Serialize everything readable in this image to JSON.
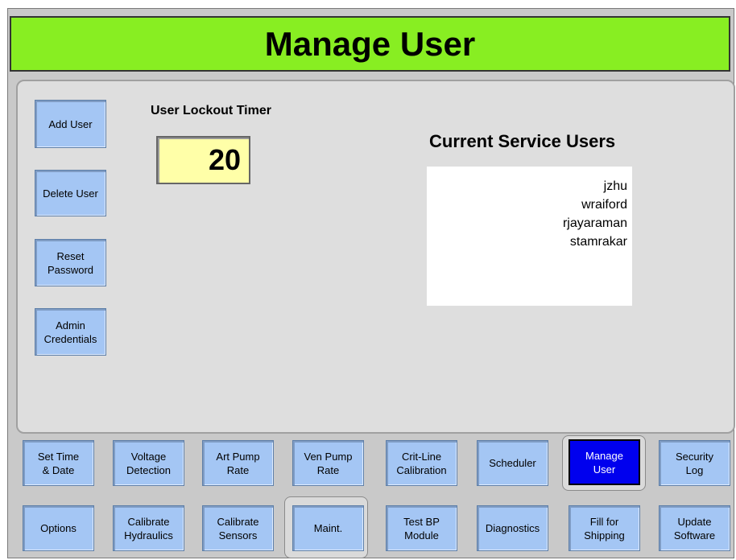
{
  "header": {
    "title": "Manage User"
  },
  "side_buttons": [
    {
      "label": "Add User"
    },
    {
      "label": "Delete User"
    },
    {
      "label": "Reset\nPassword"
    },
    {
      "label": "Admin\nCredentials"
    }
  ],
  "lockout": {
    "label": "User Lockout Timer",
    "value": "20"
  },
  "users": {
    "title": "Current Service Users",
    "items": [
      "jzhu",
      "wraiford",
      "rjayaraman",
      "stamrakar"
    ]
  },
  "tabs_row1": [
    {
      "label": "Set Time\n& Date"
    },
    {
      "label": "Voltage\nDetection"
    },
    {
      "label": "Art Pump\nRate"
    },
    {
      "label": "Ven Pump\nRate"
    },
    {
      "label": "Crit-Line\nCalibration"
    },
    {
      "label": "Scheduler"
    },
    {
      "label": "Manage\nUser",
      "active": true
    },
    {
      "label": "Security\nLog"
    }
  ],
  "tabs_row2": [
    {
      "label": "Options"
    },
    {
      "label": "Calibrate\nHydraulics"
    },
    {
      "label": "Calibrate\nSensors"
    },
    {
      "label": "Maint.",
      "active_pocket": true
    },
    {
      "label": "Test BP\nModule"
    },
    {
      "label": "Diagnostics"
    },
    {
      "label": "Fill for\nShipping"
    },
    {
      "label": "Update\nSoftware"
    }
  ],
  "colors": {
    "header_bg": "#88ee22",
    "button_bg": "#a4c6f4",
    "active_tab_bg": "#0000ee",
    "lockout_field_bg": "#ffffa8"
  }
}
